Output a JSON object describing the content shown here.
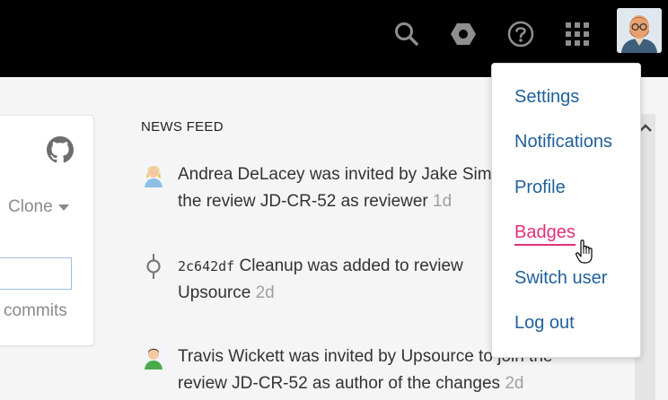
{
  "news_feed": {
    "title": "NEWS FEED",
    "items": [
      {
        "line1": "Andrea DeLacey was invited by Jake Simpson to join",
        "line2_prefix": "the review JD-CR-52 as reviewer",
        "time": "1d",
        "icon": "user-avatar-icon"
      },
      {
        "hash": "2c642df",
        "line1": "Cleanup was added to review",
        "line2_prefix": "Upsource",
        "time": "2d",
        "icon": "commit-icon"
      },
      {
        "line1": "Travis Wickett was invited by Upsource to join the",
        "line2_prefix": "review JD-CR-52 as author of the changes",
        "time": "2d",
        "icon": "user-avatar-icon"
      }
    ]
  },
  "project_card": {
    "clone_label": "Clone",
    "commits_label": "commits",
    "icon": "github-icon"
  },
  "top_bar": {
    "icons": [
      "search-icon",
      "settings-hex-icon",
      "help-icon",
      "apps-grid-icon",
      "user-avatar"
    ]
  },
  "user_menu": {
    "items": [
      "Settings",
      "Notifications",
      "Profile",
      "Badges",
      "Switch user",
      "Log out"
    ],
    "active_index": 3
  },
  "colors": {
    "topbar": "#000000",
    "menu_link": "#1f5f9a",
    "menu_active": "#e0307a"
  }
}
